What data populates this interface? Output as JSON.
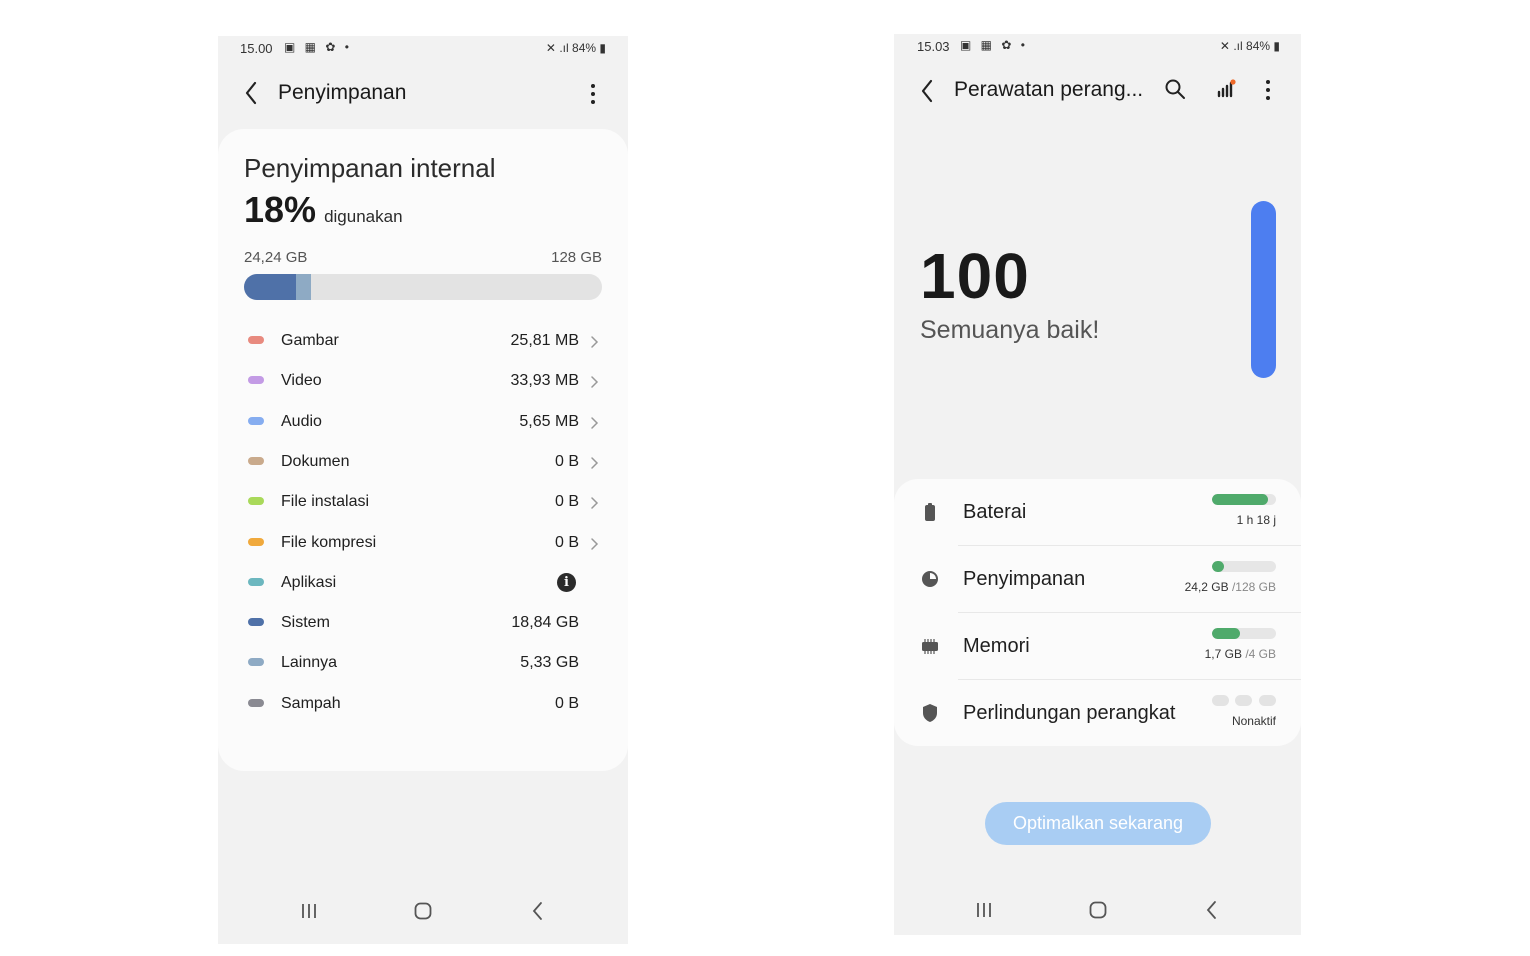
{
  "storage_screen": {
    "status_bar": {
      "time": "15.00",
      "icons": [
        "image-icon",
        "calendar-icon",
        "gear-icon",
        "dot-icon"
      ],
      "battery": "84%"
    },
    "header": {
      "title": "Penyimpanan"
    },
    "internal": {
      "title": "Penyimpanan internal",
      "percent": "18%",
      "percent_label": "digunakan",
      "used": "24,24 GB",
      "total": "128 GB",
      "used_fraction": 0.18
    },
    "categories": [
      {
        "label": "Gambar",
        "value": "25,81 MB",
        "color": "#e88a7f",
        "chevron": true
      },
      {
        "label": "Video",
        "value": "33,93 MB",
        "color": "#c39be5",
        "chevron": true
      },
      {
        "label": "Audio",
        "value": "5,65 MB",
        "color": "#86adf0",
        "chevron": true
      },
      {
        "label": "Dokumen",
        "value": "0 B",
        "color": "#c9aa8c",
        "chevron": true
      },
      {
        "label": "File instalasi",
        "value": "0 B",
        "color": "#a9d95a",
        "chevron": true
      },
      {
        "label": "File kompresi",
        "value": "0 B",
        "color": "#f0a93c",
        "chevron": true
      },
      {
        "label": "Aplikasi",
        "value": "",
        "color": "#6cb7bf",
        "chevron": false,
        "info_icon": "i"
      },
      {
        "label": "Sistem",
        "value": "18,84 GB",
        "color": "#4f71a8",
        "chevron": false
      },
      {
        "label": "Lainnya",
        "value": "5,33 GB",
        "color": "#8eaac4",
        "chevron": false
      },
      {
        "label": "Sampah",
        "value": "0 B",
        "color": "#8a8a92",
        "chevron": false
      }
    ]
  },
  "care_screen": {
    "status_bar": {
      "time": "15.03",
      "icons": [
        "image-icon",
        "calendar-icon",
        "gear-icon",
        "dot-icon"
      ],
      "battery": "84%"
    },
    "header": {
      "title": "Perawatan perang..."
    },
    "score": "100",
    "score_message": "Semuanya baik!",
    "score_level": 1.0,
    "items": [
      {
        "label": "Baterai",
        "icon": "battery-icon",
        "value": "1 h 18 j",
        "value_dim": "",
        "fill": 0.88
      },
      {
        "label": "Penyimpanan",
        "icon": "storage-pie-icon",
        "value": "24,2 GB",
        "value_dim": "/128 GB",
        "fill": 0.19
      },
      {
        "label": "Memori",
        "icon": "memory-chip-icon",
        "value": "1,7 GB",
        "value_dim": "/4 GB",
        "fill": 0.43
      },
      {
        "label": "Perlindungan perangkat",
        "icon": "shield-icon",
        "value": "Nonaktif",
        "value_dim": "",
        "fill": null
      }
    ],
    "optimize_button": "Optimalkan sekarang"
  },
  "colors": {
    "accent_blue": "#4d7ef0",
    "green": "#4faa6b",
    "button_bg": "#a9cdf3"
  }
}
